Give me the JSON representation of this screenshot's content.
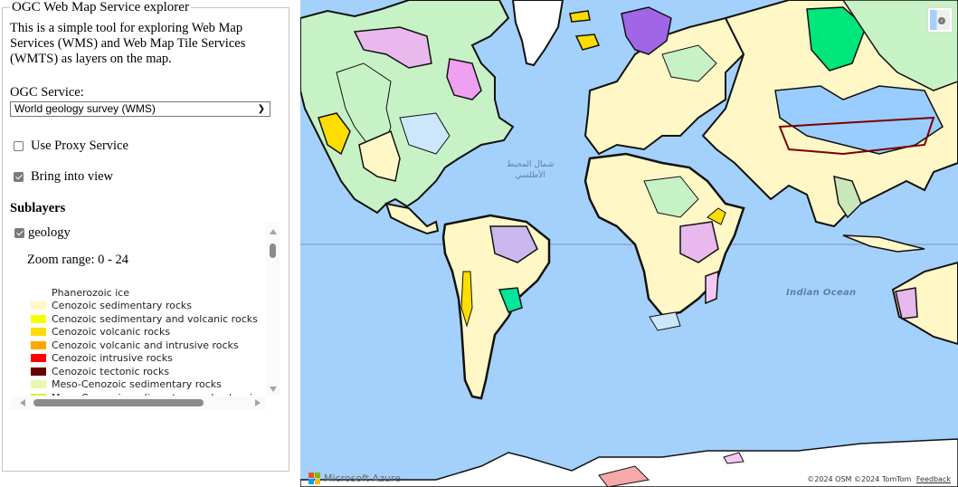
{
  "panel": {
    "title": "OGC Web Map Service explorer",
    "description": "This is a simple tool for exploring Web Map Services (WMS) and Web Map Tile Services (WMTS) as layers on the map.",
    "service_label": "OGC Service:",
    "service_selected": "World geology survey (WMS)",
    "use_proxy_label": "Use Proxy Service",
    "use_proxy_checked": false,
    "bring_into_view_label": "Bring into view",
    "bring_into_view_checked": true,
    "sublayers_heading": "Sublayers",
    "sublayer": {
      "name": "geology",
      "checked": true,
      "zoom_range": "Zoom range: 0 - 24"
    },
    "legend": [
      {
        "label": "Phanerozoic ice",
        "color": "#ffffff"
      },
      {
        "label": "Cenozoic sedimentary rocks",
        "color": "#fff7c6"
      },
      {
        "label": "Cenozoic sedimentary and volcanic rocks",
        "color": "#f4ff00"
      },
      {
        "label": "Cenozoic volcanic rocks",
        "color": "#ffdd00"
      },
      {
        "label": "Cenozoic volcanic and intrusive rocks",
        "color": "#ffa800"
      },
      {
        "label": "Cenozoic intrusive rocks",
        "color": "#ff0000"
      },
      {
        "label": "Cenozoic tectonic rocks",
        "color": "#650000"
      },
      {
        "label": "Meso-Cenozoic sedimentary rocks",
        "color": "#eaf7b0"
      },
      {
        "label": "Meso-Cenozoic sedimentary and volcanic rocks",
        "color": "#d8f23a"
      }
    ]
  },
  "map": {
    "labels": {
      "north_atlantic_ar_line1": "شمال المحيط",
      "north_atlantic_ar_line2": "الأطلسي",
      "indian_ocean": "Indian Ocean"
    },
    "brand": "Microsoft Azure",
    "brand_colors": [
      "#f25022",
      "#7fba00",
      "#00a4ef",
      "#ffb900"
    ],
    "copyright": "©2024 OSM  ©2024 TomTom",
    "feedback_label": "Feedback",
    "ocean_color": "#a3d1fb"
  }
}
